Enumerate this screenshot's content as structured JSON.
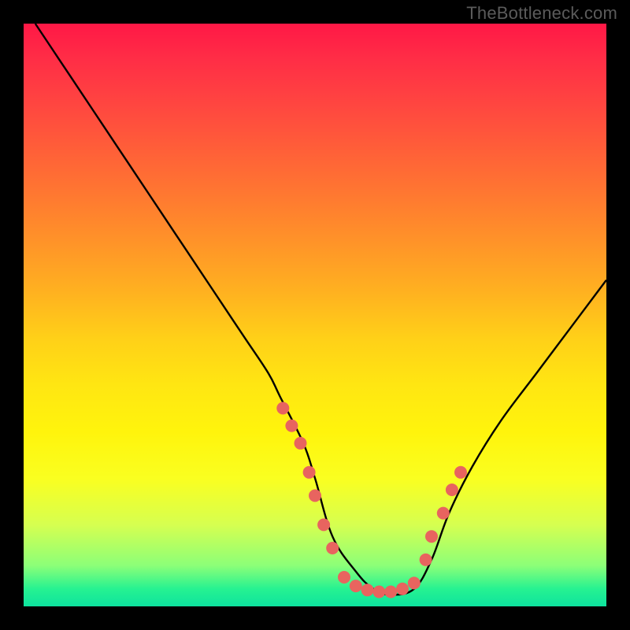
{
  "watermark": "TheBottleneck.com",
  "chart_data": {
    "type": "line",
    "title": "",
    "xlabel": "",
    "ylabel": "",
    "xlim": [
      0,
      100
    ],
    "ylim": [
      0,
      100
    ],
    "series": [
      {
        "name": "curve",
        "x": [
          2,
          6,
          10,
          14,
          18,
          22,
          26,
          30,
          34,
          38,
          42,
          44,
          48,
          50,
          53,
          57,
          60,
          63,
          67,
          70,
          73,
          77,
          82,
          88,
          94,
          100
        ],
        "y": [
          100,
          94,
          88,
          82,
          76,
          70,
          64,
          58,
          52,
          46,
          40,
          36,
          28,
          22,
          12,
          6,
          3,
          2,
          3,
          8,
          16,
          24,
          32,
          40,
          48,
          56
        ]
      }
    ],
    "markers": [
      {
        "x": 44.5,
        "y": 34
      },
      {
        "x": 46,
        "y": 31
      },
      {
        "x": 47.5,
        "y": 28
      },
      {
        "x": 49,
        "y": 23
      },
      {
        "x": 50,
        "y": 19
      },
      {
        "x": 51.5,
        "y": 14
      },
      {
        "x": 53,
        "y": 10
      },
      {
        "x": 55,
        "y": 5
      },
      {
        "x": 57,
        "y": 3.5
      },
      {
        "x": 59,
        "y": 2.8
      },
      {
        "x": 61,
        "y": 2.5
      },
      {
        "x": 63,
        "y": 2.5
      },
      {
        "x": 65,
        "y": 3
      },
      {
        "x": 67,
        "y": 4
      },
      {
        "x": 69,
        "y": 8
      },
      {
        "x": 70,
        "y": 12
      },
      {
        "x": 72,
        "y": 16
      },
      {
        "x": 73.5,
        "y": 20
      },
      {
        "x": 75,
        "y": 23
      }
    ],
    "marker_color": "#e8645f"
  }
}
